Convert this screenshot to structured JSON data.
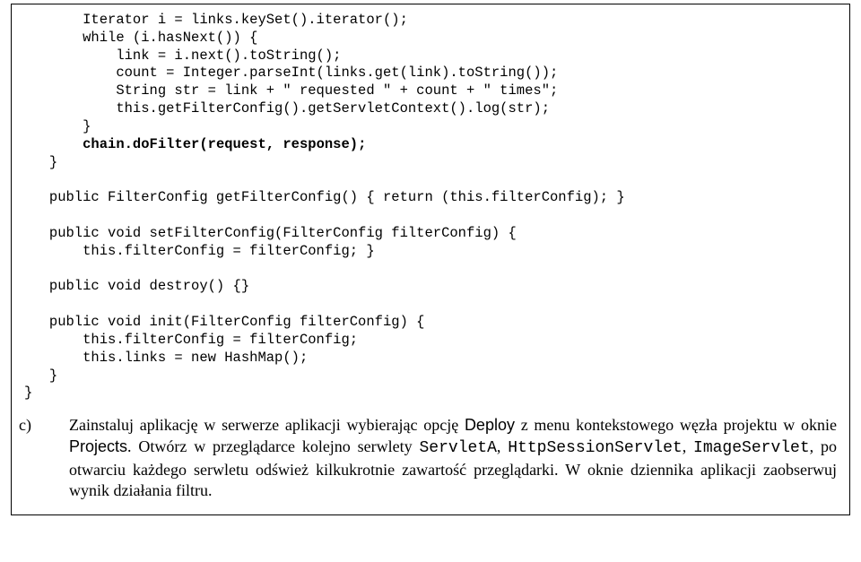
{
  "code": {
    "l01": "       Iterator i = links.keySet().iterator();",
    "l02": "       while (i.hasNext()) {",
    "l03": "           link = i.next().toString();",
    "l04": "           count = Integer.parseInt(links.get(link).toString());",
    "l05": "           String str = link + \" requested \" + count + \" times\";",
    "l06": "           this.getFilterConfig().getServletContext().log(str);",
    "l07": "       }",
    "l08a": "       ",
    "l08b": "chain.doFilter(request, response);",
    "l09": "   }",
    "l10": "",
    "l11": "   public FilterConfig getFilterConfig() { return (this.filterConfig); }",
    "l12": "",
    "l13": "   public void setFilterConfig(FilterConfig filterConfig) {",
    "l14": "       this.filterConfig = filterConfig; }",
    "l15": "",
    "l16": "   public void destroy() {}",
    "l17": "",
    "l18": "   public void init(FilterConfig filterConfig) {",
    "l19": "       this.filterConfig = filterConfig;",
    "l20": "       this.links = new HashMap();",
    "l21": "   }",
    "l22": "}"
  },
  "prose": {
    "label": "c)",
    "t1": "Zainstaluj aplikację w serwerze aplikacji wybierając opcję ",
    "deploy": "Deploy",
    "t2": " z menu kontekstowego węzła projektu w oknie ",
    "projects": "Projects",
    "t3": ". Otwórz w przeglądarce kolejno serwlety ",
    "s1": "ServletA",
    "c1": ", ",
    "s2": "HttpSessionServlet",
    "c2": ", ",
    "s3": "ImageServlet",
    "t4": ", po otwarciu każdego serwletu odśwież kilkukrotnie zawartość przeglądarki. W oknie dziennika aplikacji zaobserwuj wynik działania filtru."
  }
}
